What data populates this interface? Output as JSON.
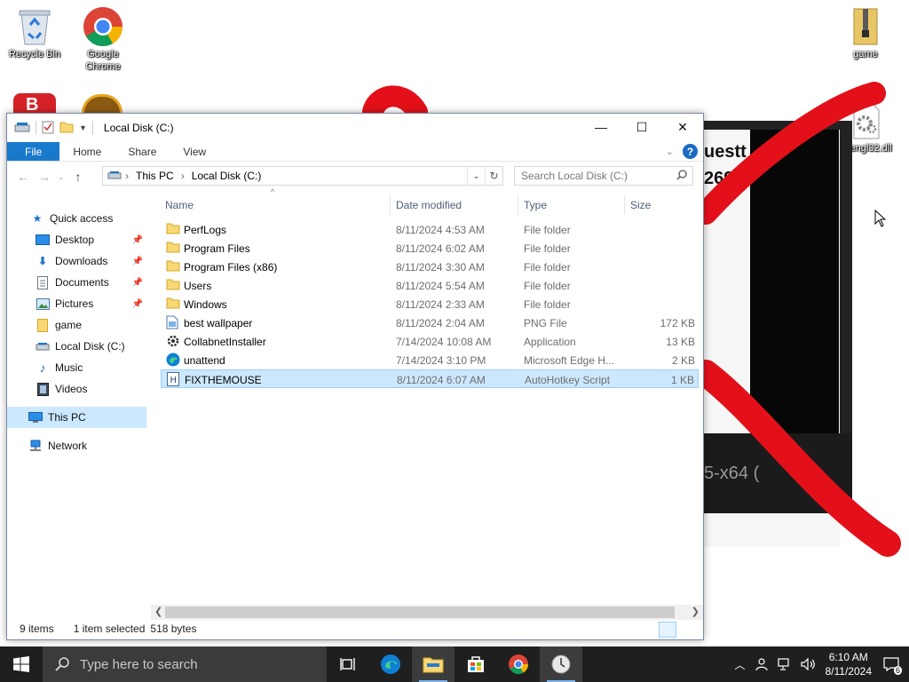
{
  "desktop": {
    "icons": [
      {
        "label": "Recycle Bin",
        "icon": "recycle-bin-icon"
      },
      {
        "label": "Google Chrome",
        "icon": "chrome-icon"
      },
      {
        "label": "game",
        "icon": "zip-folder-icon"
      },
      {
        "label": "opengl32.dll",
        "icon": "dll-gear-icon"
      }
    ],
    "background_image": {
      "text_top": "uestt",
      "text_number": "2699",
      "text_bottom": "5-x64 ("
    }
  },
  "explorer": {
    "title": "Local Disk (C:)",
    "window_buttons": {
      "minimize": "—",
      "maximize": "☐",
      "close": "✕"
    },
    "ribbon": {
      "tabs": [
        "File",
        "Home",
        "Share",
        "View"
      ],
      "help": "?"
    },
    "address": {
      "crumbs": [
        "This PC",
        "Local Disk (C:)"
      ]
    },
    "search": {
      "placeholder": "Search Local Disk (C:)"
    },
    "nav_pane": [
      {
        "label": "Quick access",
        "icon": "star-icon",
        "pinned": false
      },
      {
        "label": "Desktop",
        "icon": "desktop-icon",
        "pinned": true
      },
      {
        "label": "Downloads",
        "icon": "download-icon",
        "pinned": true
      },
      {
        "label": "Documents",
        "icon": "documents-icon",
        "pinned": true
      },
      {
        "label": "Pictures",
        "icon": "pictures-icon",
        "pinned": true
      },
      {
        "label": "game",
        "icon": "folder-icon",
        "pinned": false
      },
      {
        "label": "Local Disk (C:)",
        "icon": "drive-icon",
        "pinned": false
      },
      {
        "label": "Music",
        "icon": "music-icon",
        "pinned": false
      },
      {
        "label": "Videos",
        "icon": "videos-icon",
        "pinned": false
      },
      {
        "label": "This PC",
        "icon": "computer-icon",
        "pinned": false
      },
      {
        "label": "Network",
        "icon": "network-icon",
        "pinned": false
      }
    ],
    "columns": [
      "Name",
      "Date modified",
      "Type",
      "Size"
    ],
    "files": [
      {
        "name": "PerfLogs",
        "date": "8/11/2024 4:53 AM",
        "type": "File folder",
        "size": "",
        "icon": "folder-icon"
      },
      {
        "name": "Program Files",
        "date": "8/11/2024 6:02 AM",
        "type": "File folder",
        "size": "",
        "icon": "folder-icon"
      },
      {
        "name": "Program Files (x86)",
        "date": "8/11/2024 3:30 AM",
        "type": "File folder",
        "size": "",
        "icon": "folder-icon"
      },
      {
        "name": "Users",
        "date": "8/11/2024 5:54 AM",
        "type": "File folder",
        "size": "",
        "icon": "folder-icon"
      },
      {
        "name": "Windows",
        "date": "8/11/2024 2:33 AM",
        "type": "File folder",
        "size": "",
        "icon": "folder-icon"
      },
      {
        "name": "best wallpaper",
        "date": "8/11/2024 2:04 AM",
        "type": "PNG File",
        "size": "172 KB",
        "icon": "image-file-icon"
      },
      {
        "name": "CollabnetInstaller",
        "date": "7/14/2024 10:08 AM",
        "type": "Application",
        "size": "13 KB",
        "icon": "application-icon"
      },
      {
        "name": "unattend",
        "date": "7/14/2024 3:10 PM",
        "type": "Microsoft Edge H...",
        "size": "2 KB",
        "icon": "edge-icon"
      },
      {
        "name": "FIXTHEMOUSE",
        "date": "8/11/2024 6:07 AM",
        "type": "AutoHotkey Script",
        "size": "1 KB",
        "icon": "ahk-script-icon",
        "selected": true
      }
    ],
    "status": {
      "items": "9 items",
      "selected": "1 item selected",
      "bytes": "518 bytes"
    }
  },
  "taskbar": {
    "search_placeholder": "Type here to search",
    "apps": [
      "task-view-icon",
      "edge-icon",
      "file-explorer-icon",
      "store-icon",
      "chrome-icon",
      "clock-app-icon"
    ],
    "time": "6:10 AM",
    "date": "8/11/2024",
    "notification_count": "6"
  },
  "colors": {
    "file_tab": "#1979ca",
    "selection": "#cce8ff",
    "selection_border": "#99d1ff",
    "scribble": "#e3101a",
    "taskbar": "#1f1f1f"
  }
}
